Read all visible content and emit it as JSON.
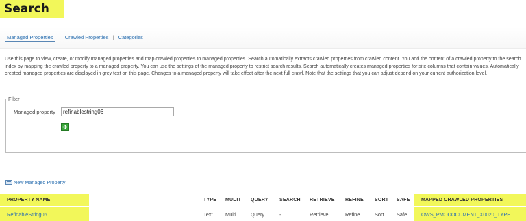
{
  "page": {
    "title": "Search"
  },
  "subnav": {
    "items": [
      {
        "label": "Managed Properties"
      },
      {
        "label": "Crawled Properties"
      },
      {
        "label": "Categories"
      }
    ],
    "separator": "|"
  },
  "description": "Use this page to view, create, or modify managed properties and map crawled properties to managed properties. Search automatically extracts crawled properties from crawled content. You add the content of a crawled property to the search index by mapping the crawled property to a managed property. You can use the settings of the managed property to restrict search results. Search automatically creates managed properties for site columns that contain values. Automatically created managed properties are displayed in grey text on this page. Changes to a managed property will take effect after the next full crawl. Note that the settings that you can adjust depend on your current authorization level.",
  "filter": {
    "legend": "Filter",
    "field_label": "Managed property",
    "field_value": "refinablestring06"
  },
  "new_property": {
    "label": "New Managed Property"
  },
  "table": {
    "headers": {
      "name": "PROPERTY NAME",
      "type": "TYPE",
      "multi": "MULTI",
      "query": "QUERY",
      "search": "SEARCH",
      "retrieve": "RETRIEVE",
      "refine": "REFINE",
      "sort": "SORT",
      "safe": "SAFE",
      "mapped": "MAPPED CRAWLED PROPERTIES"
    },
    "rows": [
      {
        "name": "RefinableString06",
        "type": "Text",
        "multi": "Multi",
        "query": "Query",
        "search": "-",
        "retrieve": "Retrieve",
        "refine": "Refine",
        "sort": "Sort",
        "safe": "Safe",
        "mapped": "OWS_PMODOCUMENT_X0020_TYPE"
      }
    ]
  },
  "colors": {
    "highlight": "#f2f75a",
    "link": "#2a6fb0",
    "go_button": "#3aa63a"
  }
}
